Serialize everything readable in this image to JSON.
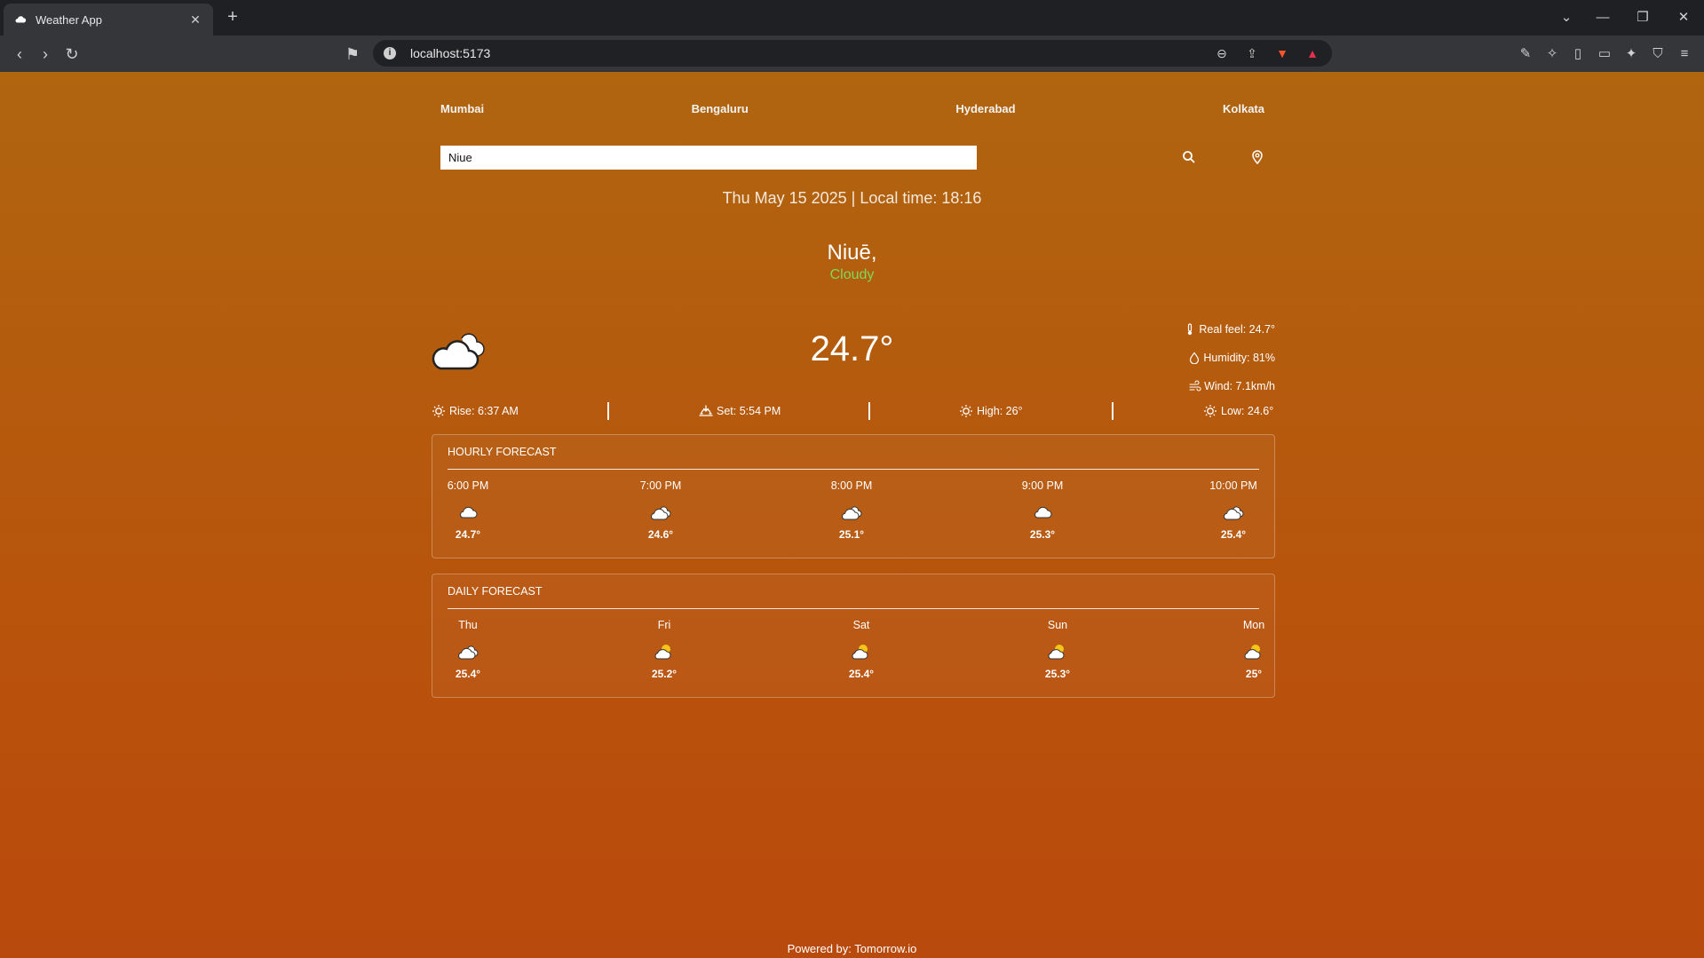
{
  "browser": {
    "tab_title": "Weather App",
    "tab_close": "✕",
    "new_tab": "+",
    "url": "localhost:5173"
  },
  "nav": {
    "cities": [
      "Mumbai",
      "Bengaluru",
      "Hyderabad",
      "Kolkata"
    ]
  },
  "search": {
    "value": "Niue"
  },
  "datetime": "Thu May 15 2025 | Local time: 18:16",
  "location": {
    "name": "Niuē,",
    "condition": "Cloudy"
  },
  "current": {
    "temperature": "24.7°",
    "real_feel": "Real feel: 24.7°",
    "humidity": "Humidity: 81%",
    "wind": "Wind: 7.1km/h",
    "sunrise": "Rise: 6:37 AM",
    "sunset": "Set: 5:54 PM",
    "high": "High: 26°",
    "low": "Low: 24.6°"
  },
  "hourly": {
    "title": "HOURLY FORECAST",
    "items": [
      {
        "label": "6:00 PM",
        "icon": "cloud-icon",
        "temp": "24.7°"
      },
      {
        "label": "7:00 PM",
        "icon": "cloud-icon",
        "temp": "24.6°"
      },
      {
        "label": "8:00 PM",
        "icon": "cloud-icon",
        "temp": "25.1°"
      },
      {
        "label": "9:00 PM",
        "icon": "cloud-icon",
        "temp": "25.3°"
      },
      {
        "label": "10:00 PM",
        "icon": "cloud-icon",
        "temp": "25.4°"
      }
    ]
  },
  "daily": {
    "title": "DAILY FORECAST",
    "items": [
      {
        "label": "Thu",
        "icon": "cloud-icon",
        "temp": "25.4°"
      },
      {
        "label": "Fri",
        "icon": "partly-sunny-icon",
        "temp": "25.2°"
      },
      {
        "label": "Sat",
        "icon": "partly-sunny-icon",
        "temp": "25.4°"
      },
      {
        "label": "Sun",
        "icon": "partly-sunny-icon",
        "temp": "25.3°"
      },
      {
        "label": "Mon",
        "icon": "partly-sunny-icon",
        "temp": "25°"
      }
    ]
  },
  "footer": "Powered by: Tomorrow.io",
  "colors": {
    "background_top": "#b0650f",
    "background_bottom": "#b94a0d",
    "condition": "#7ed957"
  }
}
